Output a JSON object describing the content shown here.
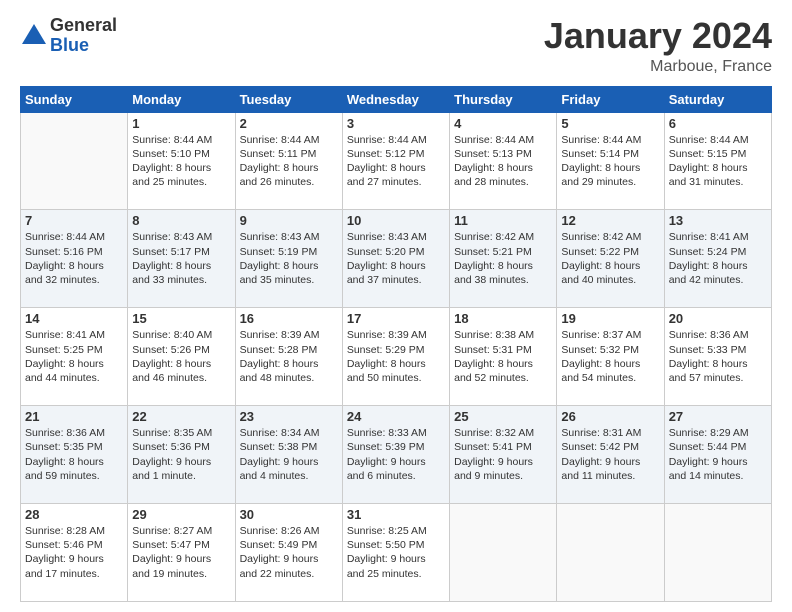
{
  "logo": {
    "general": "General",
    "blue": "Blue"
  },
  "header": {
    "month": "January 2024",
    "location": "Marboue, France"
  },
  "days": [
    "Sunday",
    "Monday",
    "Tuesday",
    "Wednesday",
    "Thursday",
    "Friday",
    "Saturday"
  ],
  "weeks": [
    [
      {
        "day": "",
        "sunrise": "",
        "sunset": "",
        "daylight": ""
      },
      {
        "day": "1",
        "sunrise": "Sunrise: 8:44 AM",
        "sunset": "Sunset: 5:10 PM",
        "daylight": "Daylight: 8 hours and 25 minutes."
      },
      {
        "day": "2",
        "sunrise": "Sunrise: 8:44 AM",
        "sunset": "Sunset: 5:11 PM",
        "daylight": "Daylight: 8 hours and 26 minutes."
      },
      {
        "day": "3",
        "sunrise": "Sunrise: 8:44 AM",
        "sunset": "Sunset: 5:12 PM",
        "daylight": "Daylight: 8 hours and 27 minutes."
      },
      {
        "day": "4",
        "sunrise": "Sunrise: 8:44 AM",
        "sunset": "Sunset: 5:13 PM",
        "daylight": "Daylight: 8 hours and 28 minutes."
      },
      {
        "day": "5",
        "sunrise": "Sunrise: 8:44 AM",
        "sunset": "Sunset: 5:14 PM",
        "daylight": "Daylight: 8 hours and 29 minutes."
      },
      {
        "day": "6",
        "sunrise": "Sunrise: 8:44 AM",
        "sunset": "Sunset: 5:15 PM",
        "daylight": "Daylight: 8 hours and 31 minutes."
      }
    ],
    [
      {
        "day": "7",
        "sunrise": "Sunrise: 8:44 AM",
        "sunset": "Sunset: 5:16 PM",
        "daylight": "Daylight: 8 hours and 32 minutes."
      },
      {
        "day": "8",
        "sunrise": "Sunrise: 8:43 AM",
        "sunset": "Sunset: 5:17 PM",
        "daylight": "Daylight: 8 hours and 33 minutes."
      },
      {
        "day": "9",
        "sunrise": "Sunrise: 8:43 AM",
        "sunset": "Sunset: 5:19 PM",
        "daylight": "Daylight: 8 hours and 35 minutes."
      },
      {
        "day": "10",
        "sunrise": "Sunrise: 8:43 AM",
        "sunset": "Sunset: 5:20 PM",
        "daylight": "Daylight: 8 hours and 37 minutes."
      },
      {
        "day": "11",
        "sunrise": "Sunrise: 8:42 AM",
        "sunset": "Sunset: 5:21 PM",
        "daylight": "Daylight: 8 hours and 38 minutes."
      },
      {
        "day": "12",
        "sunrise": "Sunrise: 8:42 AM",
        "sunset": "Sunset: 5:22 PM",
        "daylight": "Daylight: 8 hours and 40 minutes."
      },
      {
        "day": "13",
        "sunrise": "Sunrise: 8:41 AM",
        "sunset": "Sunset: 5:24 PM",
        "daylight": "Daylight: 8 hours and 42 minutes."
      }
    ],
    [
      {
        "day": "14",
        "sunrise": "Sunrise: 8:41 AM",
        "sunset": "Sunset: 5:25 PM",
        "daylight": "Daylight: 8 hours and 44 minutes."
      },
      {
        "day": "15",
        "sunrise": "Sunrise: 8:40 AM",
        "sunset": "Sunset: 5:26 PM",
        "daylight": "Daylight: 8 hours and 46 minutes."
      },
      {
        "day": "16",
        "sunrise": "Sunrise: 8:39 AM",
        "sunset": "Sunset: 5:28 PM",
        "daylight": "Daylight: 8 hours and 48 minutes."
      },
      {
        "day": "17",
        "sunrise": "Sunrise: 8:39 AM",
        "sunset": "Sunset: 5:29 PM",
        "daylight": "Daylight: 8 hours and 50 minutes."
      },
      {
        "day": "18",
        "sunrise": "Sunrise: 8:38 AM",
        "sunset": "Sunset: 5:31 PM",
        "daylight": "Daylight: 8 hours and 52 minutes."
      },
      {
        "day": "19",
        "sunrise": "Sunrise: 8:37 AM",
        "sunset": "Sunset: 5:32 PM",
        "daylight": "Daylight: 8 hours and 54 minutes."
      },
      {
        "day": "20",
        "sunrise": "Sunrise: 8:36 AM",
        "sunset": "Sunset: 5:33 PM",
        "daylight": "Daylight: 8 hours and 57 minutes."
      }
    ],
    [
      {
        "day": "21",
        "sunrise": "Sunrise: 8:36 AM",
        "sunset": "Sunset: 5:35 PM",
        "daylight": "Daylight: 8 hours and 59 minutes."
      },
      {
        "day": "22",
        "sunrise": "Sunrise: 8:35 AM",
        "sunset": "Sunset: 5:36 PM",
        "daylight": "Daylight: 9 hours and 1 minute."
      },
      {
        "day": "23",
        "sunrise": "Sunrise: 8:34 AM",
        "sunset": "Sunset: 5:38 PM",
        "daylight": "Daylight: 9 hours and 4 minutes."
      },
      {
        "day": "24",
        "sunrise": "Sunrise: 8:33 AM",
        "sunset": "Sunset: 5:39 PM",
        "daylight": "Daylight: 9 hours and 6 minutes."
      },
      {
        "day": "25",
        "sunrise": "Sunrise: 8:32 AM",
        "sunset": "Sunset: 5:41 PM",
        "daylight": "Daylight: 9 hours and 9 minutes."
      },
      {
        "day": "26",
        "sunrise": "Sunrise: 8:31 AM",
        "sunset": "Sunset: 5:42 PM",
        "daylight": "Daylight: 9 hours and 11 minutes."
      },
      {
        "day": "27",
        "sunrise": "Sunrise: 8:29 AM",
        "sunset": "Sunset: 5:44 PM",
        "daylight": "Daylight: 9 hours and 14 minutes."
      }
    ],
    [
      {
        "day": "28",
        "sunrise": "Sunrise: 8:28 AM",
        "sunset": "Sunset: 5:46 PM",
        "daylight": "Daylight: 9 hours and 17 minutes."
      },
      {
        "day": "29",
        "sunrise": "Sunrise: 8:27 AM",
        "sunset": "Sunset: 5:47 PM",
        "daylight": "Daylight: 9 hours and 19 minutes."
      },
      {
        "day": "30",
        "sunrise": "Sunrise: 8:26 AM",
        "sunset": "Sunset: 5:49 PM",
        "daylight": "Daylight: 9 hours and 22 minutes."
      },
      {
        "day": "31",
        "sunrise": "Sunrise: 8:25 AM",
        "sunset": "Sunset: 5:50 PM",
        "daylight": "Daylight: 9 hours and 25 minutes."
      },
      {
        "day": "",
        "sunrise": "",
        "sunset": "",
        "daylight": ""
      },
      {
        "day": "",
        "sunrise": "",
        "sunset": "",
        "daylight": ""
      },
      {
        "day": "",
        "sunrise": "",
        "sunset": "",
        "daylight": ""
      }
    ]
  ]
}
